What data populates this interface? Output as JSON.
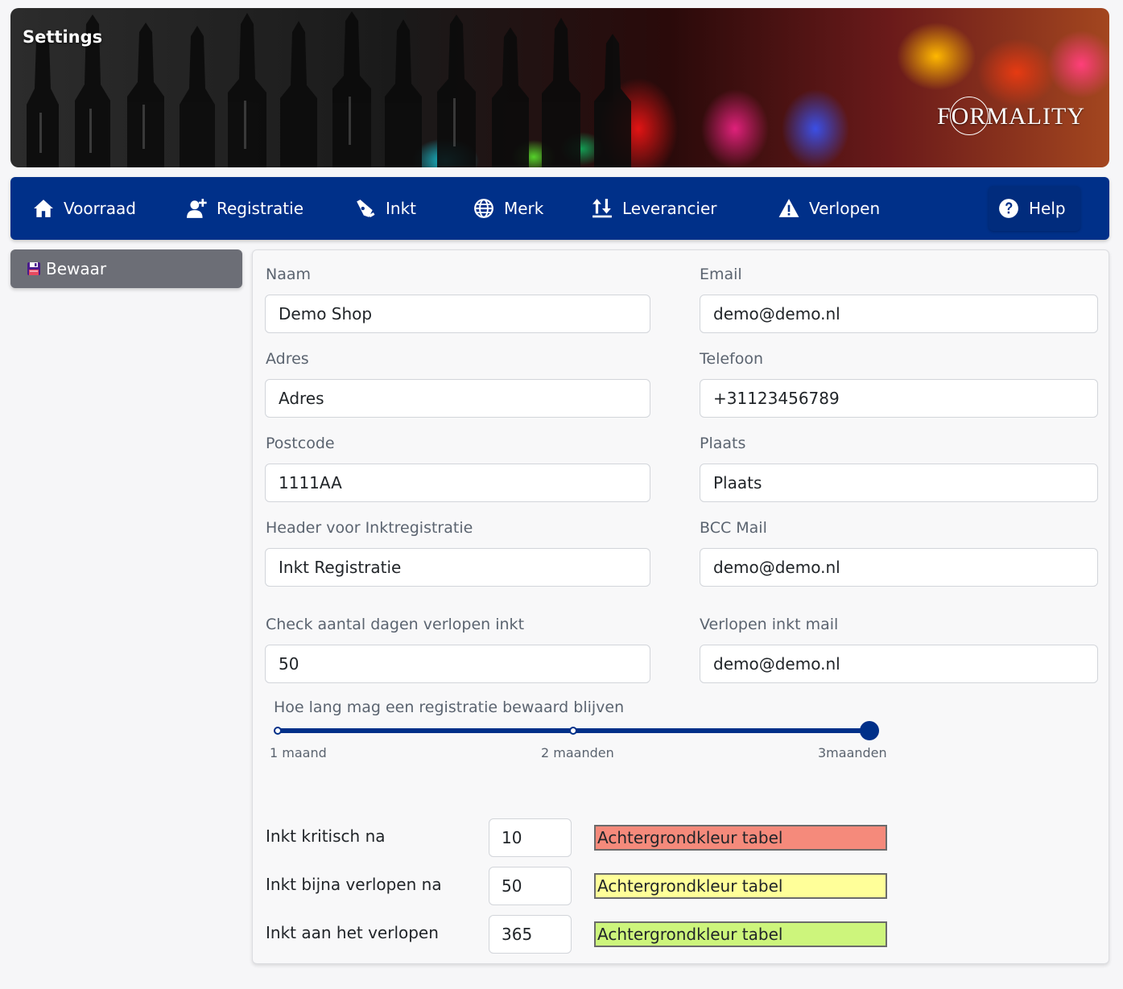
{
  "banner": {
    "title": "Settings",
    "brand": "FORMALITY"
  },
  "nav": {
    "items": [
      {
        "label": "Voorraad",
        "icon": "home-icon"
      },
      {
        "label": "Registratie",
        "icon": "add-user-icon"
      },
      {
        "label": "Inkt",
        "icon": "pen-nib-icon"
      },
      {
        "label": "Merk",
        "icon": "globe-icon"
      },
      {
        "label": "Leverancier",
        "icon": "sort-arrows-icon"
      },
      {
        "label": "Verlopen",
        "icon": "warning-icon"
      }
    ],
    "help": {
      "label": "Help",
      "icon": "question-circle-icon"
    }
  },
  "sidebar": {
    "save_label": "Bewaar",
    "save_icon": "floppy-disk-icon"
  },
  "form": {
    "naam": {
      "label": "Naam",
      "value": "Demo Shop"
    },
    "email": {
      "label": "Email",
      "value": "demo@demo.nl"
    },
    "adres": {
      "label": "Adres",
      "value": "Adres"
    },
    "telefoon": {
      "label": "Telefoon",
      "value": "+31123456789"
    },
    "postcode": {
      "label": "Postcode",
      "value": "1111AA"
    },
    "plaats": {
      "label": "Plaats",
      "value": "Plaats"
    },
    "header": {
      "label": "Header voor Inktregistratie",
      "value": "Inkt Registratie"
    },
    "bcc": {
      "label": "BCC Mail",
      "value": "demo@demo.nl"
    },
    "check_dagen": {
      "label": "Check aantal dagen verlopen inkt",
      "value": "50"
    },
    "verlopen_mail": {
      "label": "Verlopen inkt mail",
      "value": "demo@demo.nl"
    }
  },
  "retention": {
    "label": "Hoe lang mag een registratie bewaard blijven",
    "ticks": [
      "1 maand",
      "2 maanden",
      "3maanden"
    ],
    "selected_index": 2
  },
  "thresholds": [
    {
      "label": "Inkt kritisch na",
      "value": "10",
      "color_label": "Achtergrondkleur tabel",
      "color": "#f58a7b"
    },
    {
      "label": "Inkt bijna verlopen na",
      "value": "50",
      "color_label": "Achtergrondkleur tabel",
      "color": "#ffff99"
    },
    {
      "label": "Inkt aan het verlopen",
      "value": "365",
      "color_label": "Achtergrondkleur tabel",
      "color": "#cdf57c"
    }
  ]
}
